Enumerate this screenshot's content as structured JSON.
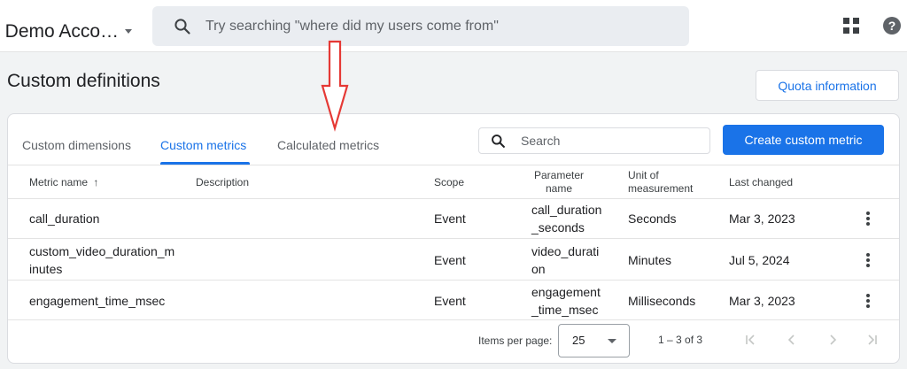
{
  "header": {
    "account_name": ": Demo Acco…",
    "search_placeholder": "Try searching \"where did my users come from\"",
    "help_glyph": "?"
  },
  "page": {
    "title": "Custom definitions",
    "quota_button": "Quota information"
  },
  "tabs": [
    {
      "label": "Custom dimensions",
      "active": false
    },
    {
      "label": "Custom metrics",
      "active": true
    },
    {
      "label": "Calculated metrics",
      "active": false
    }
  ],
  "toolbar": {
    "search_placeholder": "Search",
    "create_button": "Create custom metric"
  },
  "table": {
    "headers": {
      "metric_name": "Metric name",
      "sort_arrow": "↑",
      "description": "Description",
      "scope": "Scope",
      "parameter_name_1": "Parameter",
      "parameter_name_2": "name",
      "unit_1": "Unit of",
      "unit_2": "measurement",
      "last_changed": "Last changed"
    },
    "rows": [
      {
        "name_1": "call_duration",
        "name_2": "",
        "description": "",
        "scope": "Event",
        "param_1": "call_duration",
        "param_2": "_seconds",
        "unit": "Seconds",
        "last_changed": "Mar 3, 2023"
      },
      {
        "name_1": "custom_video_duration_m",
        "name_2": "inutes",
        "description": "",
        "scope": "Event",
        "param_1": "video_durati",
        "param_2": "on",
        "unit": "Minutes",
        "last_changed": "Jul 5, 2024"
      },
      {
        "name_1": "engagement_time_msec",
        "name_2": "",
        "description": "",
        "scope": "Event",
        "param_1": "engagement",
        "param_2": "_time_msec",
        "unit": "Milliseconds",
        "last_changed": "Mar 3, 2023"
      }
    ]
  },
  "pagination": {
    "items_per_page_label": "Items per page:",
    "items_per_page": "25",
    "range": "1 – 3 of 3"
  },
  "colors": {
    "accent": "#1a73e8",
    "annotation_arrow": "#e53935"
  },
  "icons": [
    "search-icon",
    "apps-grid-icon",
    "help-icon",
    "sort-arrow-up-icon",
    "more-vert-icon",
    "first-page-icon",
    "prev-page-icon",
    "next-page-icon",
    "last-page-icon",
    "chevron-down-icon",
    "red-arrow-annotation"
  ]
}
